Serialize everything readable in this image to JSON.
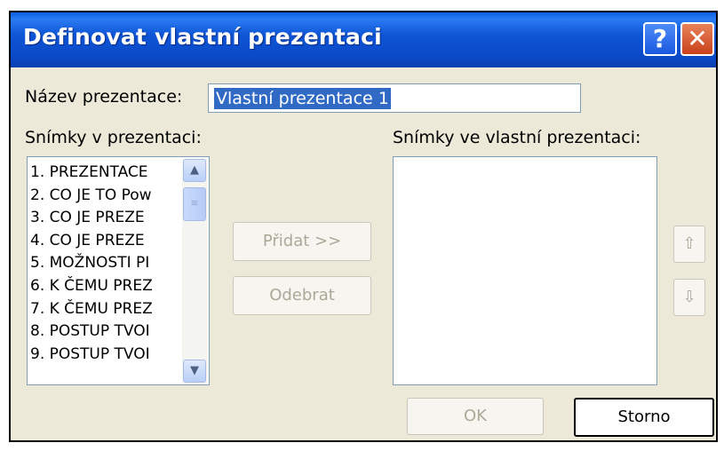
{
  "window": {
    "title": "Definovat vlastní prezentaci",
    "help_button": "?",
    "close_button": "✕"
  },
  "name_field": {
    "label": "Název prezentace:",
    "value": "Vlastní prezentace 1"
  },
  "source_list": {
    "label": "Snímky v prezentaci:",
    "items": [
      "1. PREZENTACE",
      "2. CO JE TO Pow",
      "3. CO JE PREZE",
      "4. CO JE PREZE",
      "5. MOŽNOSTI PI",
      "6. K ČEMU PREZ",
      "7. K ČEMU PREZ",
      "8. POSTUP TVOI",
      "9. POSTUP TVOI"
    ]
  },
  "target_list": {
    "label": "Snímky ve vlastní prezentaci:"
  },
  "buttons": {
    "add": "Přidat >>",
    "remove": "Odebrat",
    "move_up": "⇧",
    "move_down": "⇩",
    "ok": "OK",
    "cancel": "Storno"
  },
  "colors": {
    "title_bar": "#0a49c8",
    "dialog_face": "#ece9d8",
    "selection": "#316ac5"
  }
}
